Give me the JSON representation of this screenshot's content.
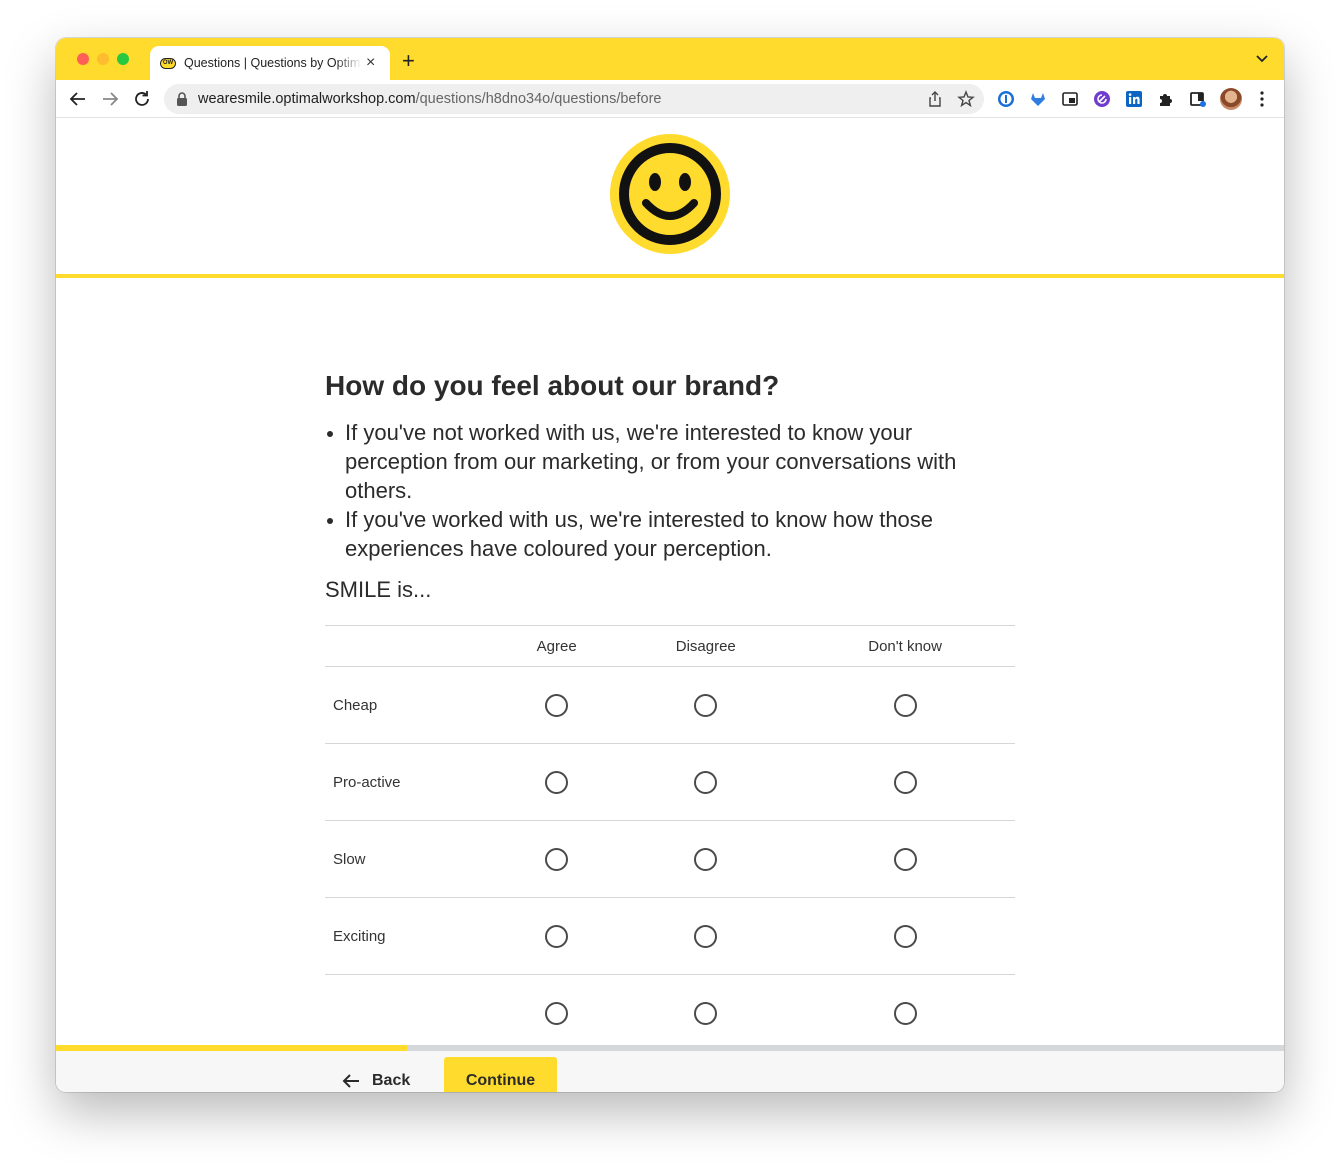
{
  "browser": {
    "tab_title": "Questions | Questions by Optimal Workshop",
    "tab_favicon_text": "OW",
    "url_host": "wearesmile.optimalworkshop.com",
    "url_path": "/questions/h8dno34o/questions/before"
  },
  "question": {
    "title": "How do you feel about our brand?",
    "bullets": [
      "If you've not worked with us, we're interested to know your perception from our marketing, or from your conversations with others.",
      "If you've worked with us, we're interested to know how those experiences have coloured your perception."
    ],
    "prompt": "SMILE is..."
  },
  "matrix": {
    "columns": [
      "Agree",
      "Disagree",
      "Don't know"
    ],
    "rows": [
      "Cheap",
      "Pro-active",
      "Slow",
      "Exciting"
    ]
  },
  "progress": {
    "fraction": 0.286
  },
  "footer": {
    "back_label": "Back",
    "continue_label": "Continue"
  },
  "colors": {
    "brand_yellow": "#ffdb2e",
    "text": "#2b2b2b"
  }
}
